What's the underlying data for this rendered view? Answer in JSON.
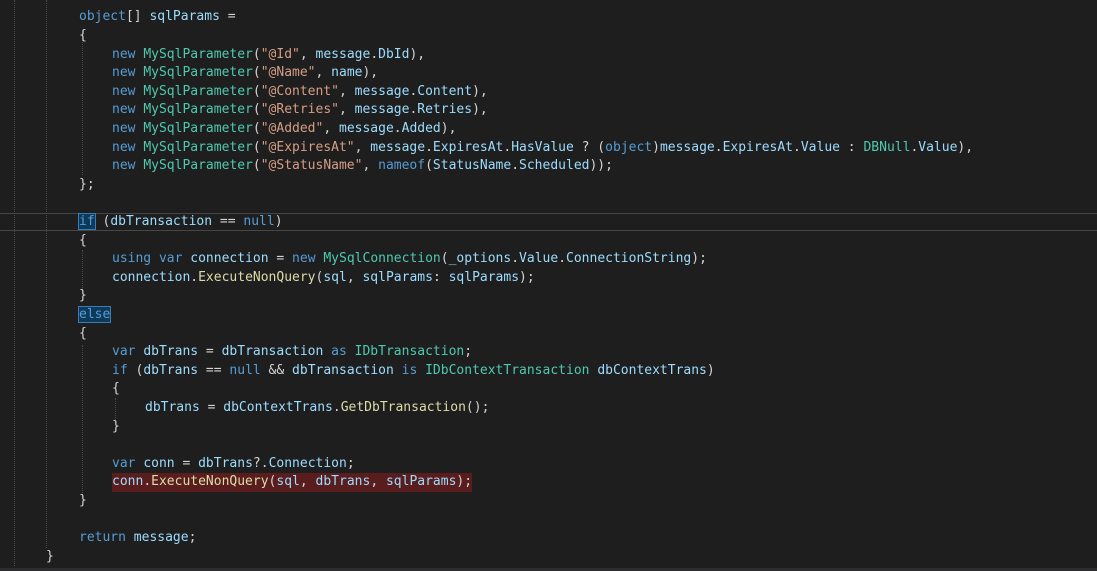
{
  "editor": {
    "colors": {
      "background": "#1e1e1e",
      "keyword": "#569cd6",
      "type": "#4ec9b0",
      "string": "#d69d85",
      "variable": "#9cdcfe",
      "method": "#dcdcaa",
      "text": "#d4d4d4",
      "error_highlight": "#5a1d1d"
    },
    "lines": [
      [
        [
          "kw",
          "object"
        ],
        [
          "pun",
          "[] "
        ],
        [
          "var",
          "sqlParams"
        ],
        [
          "pun",
          " ="
        ]
      ],
      [
        [
          "pun",
          "{"
        ]
      ],
      [
        [
          "kw",
          "new "
        ],
        [
          "typ",
          "MySqlParameter"
        ],
        [
          "pun",
          "("
        ],
        [
          "str",
          "\"@Id\""
        ],
        [
          "pun",
          ", "
        ],
        [
          "var",
          "message"
        ],
        [
          "pun",
          "."
        ],
        [
          "var",
          "DbId"
        ],
        [
          "pun",
          "),"
        ]
      ],
      [
        [
          "kw",
          "new "
        ],
        [
          "typ",
          "MySqlParameter"
        ],
        [
          "pun",
          "("
        ],
        [
          "str",
          "\"@Name\""
        ],
        [
          "pun",
          ", "
        ],
        [
          "var",
          "name"
        ],
        [
          "pun",
          "),"
        ]
      ],
      [
        [
          "kw",
          "new "
        ],
        [
          "typ",
          "MySqlParameter"
        ],
        [
          "pun",
          "("
        ],
        [
          "str",
          "\"@Content\""
        ],
        [
          "pun",
          ", "
        ],
        [
          "var",
          "message"
        ],
        [
          "pun",
          "."
        ],
        [
          "var",
          "Content"
        ],
        [
          "pun",
          "),"
        ]
      ],
      [
        [
          "kw",
          "new "
        ],
        [
          "typ",
          "MySqlParameter"
        ],
        [
          "pun",
          "("
        ],
        [
          "str",
          "\"@Retries\""
        ],
        [
          "pun",
          ", "
        ],
        [
          "var",
          "message"
        ],
        [
          "pun",
          "."
        ],
        [
          "var",
          "Retries"
        ],
        [
          "pun",
          "),"
        ]
      ],
      [
        [
          "kw",
          "new "
        ],
        [
          "typ",
          "MySqlParameter"
        ],
        [
          "pun",
          "("
        ],
        [
          "str",
          "\"@Added\""
        ],
        [
          "pun",
          ", "
        ],
        [
          "var",
          "message"
        ],
        [
          "pun",
          "."
        ],
        [
          "var",
          "Added"
        ],
        [
          "pun",
          "),"
        ]
      ],
      [
        [
          "kw",
          "new "
        ],
        [
          "typ",
          "MySqlParameter"
        ],
        [
          "pun",
          "("
        ],
        [
          "str",
          "\"@ExpiresAt\""
        ],
        [
          "pun",
          ", "
        ],
        [
          "var",
          "message"
        ],
        [
          "pun",
          "."
        ],
        [
          "var",
          "ExpiresAt"
        ],
        [
          "pun",
          "."
        ],
        [
          "var",
          "HasValue"
        ],
        [
          "pun",
          " ? ("
        ],
        [
          "kw",
          "object"
        ],
        [
          "pun",
          ")"
        ],
        [
          "var",
          "message"
        ],
        [
          "pun",
          "."
        ],
        [
          "var",
          "ExpiresAt"
        ],
        [
          "pun",
          "."
        ],
        [
          "var",
          "Value"
        ],
        [
          "pun",
          " : "
        ],
        [
          "typ",
          "DBNull"
        ],
        [
          "pun",
          "."
        ],
        [
          "var",
          "Value"
        ],
        [
          "pun",
          "),"
        ]
      ],
      [
        [
          "kw",
          "new "
        ],
        [
          "typ",
          "MySqlParameter"
        ],
        [
          "pun",
          "("
        ],
        [
          "str",
          "\"@StatusName\""
        ],
        [
          "pun",
          ", "
        ],
        [
          "kw",
          "nameof"
        ],
        [
          "pun",
          "("
        ],
        [
          "var",
          "StatusName"
        ],
        [
          "pun",
          "."
        ],
        [
          "var",
          "Scheduled"
        ],
        [
          "pun",
          "));"
        ]
      ],
      [
        [
          "pun",
          "};"
        ]
      ],
      [],
      [
        [
          "ctl",
          "if"
        ],
        [
          "pun",
          " ("
        ],
        [
          "var",
          "dbTransaction"
        ],
        [
          "pun",
          " == "
        ],
        [
          "kw",
          "null"
        ],
        [
          "pun",
          ")"
        ]
      ],
      [
        [
          "pun",
          "{"
        ]
      ],
      [
        [
          "kw",
          "using var "
        ],
        [
          "var",
          "connection"
        ],
        [
          "pun",
          " = "
        ],
        [
          "kw",
          "new "
        ],
        [
          "typ",
          "MySqlConnection"
        ],
        [
          "pun",
          "("
        ],
        [
          "var",
          "_options"
        ],
        [
          "pun",
          "."
        ],
        [
          "var",
          "Value"
        ],
        [
          "pun",
          "."
        ],
        [
          "var",
          "ConnectionString"
        ],
        [
          "pun",
          ");"
        ]
      ],
      [
        [
          "var",
          "connection"
        ],
        [
          "pun",
          "."
        ],
        [
          "mth",
          "ExecuteNonQuery"
        ],
        [
          "pun",
          "("
        ],
        [
          "var",
          "sql"
        ],
        [
          "pun",
          ", "
        ],
        [
          "var",
          "sqlParams"
        ],
        [
          "pun",
          ": "
        ],
        [
          "var",
          "sqlParams"
        ],
        [
          "pun",
          ");"
        ]
      ],
      [
        [
          "pun",
          "}"
        ]
      ],
      [
        [
          "ctl",
          "else"
        ]
      ],
      [
        [
          "pun",
          "{"
        ]
      ],
      [
        [
          "kw",
          "var "
        ],
        [
          "var",
          "dbTrans"
        ],
        [
          "pun",
          " = "
        ],
        [
          "var",
          "dbTransaction"
        ],
        [
          "kw",
          " as "
        ],
        [
          "typ",
          "IDbTransaction"
        ],
        [
          "pun",
          ";"
        ]
      ],
      [
        [
          "ctl",
          "if"
        ],
        [
          "pun",
          " ("
        ],
        [
          "var",
          "dbTrans"
        ],
        [
          "pun",
          " == "
        ],
        [
          "kw",
          "null"
        ],
        [
          "pun",
          " && "
        ],
        [
          "var",
          "dbTransaction"
        ],
        [
          "kw",
          " is "
        ],
        [
          "typ",
          "IDbContextTransaction"
        ],
        [
          "pun",
          " "
        ],
        [
          "var",
          "dbContextTrans"
        ],
        [
          "pun",
          ")"
        ]
      ],
      [
        [
          "pun",
          "{"
        ]
      ],
      [
        [
          "var",
          "dbTrans"
        ],
        [
          "pun",
          " = "
        ],
        [
          "var",
          "dbContextTrans"
        ],
        [
          "pun",
          "."
        ],
        [
          "mth",
          "GetDbTransaction"
        ],
        [
          "pun",
          "();"
        ]
      ],
      [
        [
          "pun",
          "}"
        ]
      ],
      [],
      [
        [
          "kw",
          "var "
        ],
        [
          "var",
          "conn"
        ],
        [
          "pun",
          " = "
        ],
        [
          "var",
          "dbTrans"
        ],
        [
          "pun",
          "?."
        ],
        [
          "var",
          "Connection"
        ],
        [
          "pun",
          ";"
        ]
      ],
      [
        [
          "var",
          "conn"
        ],
        [
          "pun",
          "."
        ],
        [
          "mth",
          "ExecuteNonQuery"
        ],
        [
          "pun",
          "("
        ],
        [
          "var",
          "sql"
        ],
        [
          "pun",
          ", "
        ],
        [
          "var",
          "dbTrans"
        ],
        [
          "pun",
          ", "
        ],
        [
          "var",
          "sqlParams"
        ],
        [
          "pun",
          ");"
        ]
      ],
      [
        [
          "pun",
          "}"
        ]
      ],
      [],
      [
        [
          "ctl",
          "return "
        ],
        [
          "var",
          "message"
        ],
        [
          "pun",
          ";"
        ]
      ],
      [
        [
          "pun",
          "}"
        ]
      ]
    ]
  }
}
